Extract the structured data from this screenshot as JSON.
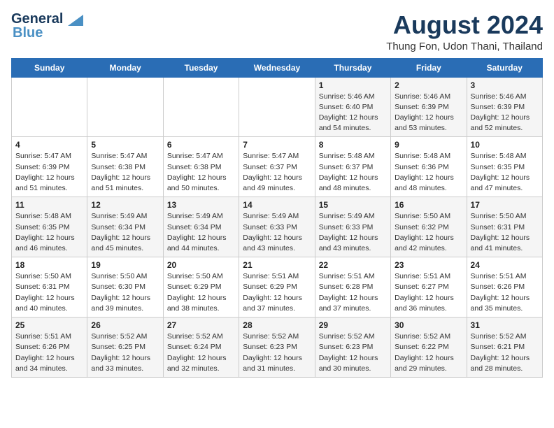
{
  "logo": {
    "line1": "General",
    "line2": "Blue"
  },
  "header": {
    "month_year": "August 2024",
    "location": "Thung Fon, Udon Thani, Thailand"
  },
  "days_of_week": [
    "Sunday",
    "Monday",
    "Tuesday",
    "Wednesday",
    "Thursday",
    "Friday",
    "Saturday"
  ],
  "weeks": [
    [
      {
        "num": "",
        "info": ""
      },
      {
        "num": "",
        "info": ""
      },
      {
        "num": "",
        "info": ""
      },
      {
        "num": "",
        "info": ""
      },
      {
        "num": "1",
        "info": "Sunrise: 5:46 AM\nSunset: 6:40 PM\nDaylight: 12 hours\nand 54 minutes."
      },
      {
        "num": "2",
        "info": "Sunrise: 5:46 AM\nSunset: 6:39 PM\nDaylight: 12 hours\nand 53 minutes."
      },
      {
        "num": "3",
        "info": "Sunrise: 5:46 AM\nSunset: 6:39 PM\nDaylight: 12 hours\nand 52 minutes."
      }
    ],
    [
      {
        "num": "4",
        "info": "Sunrise: 5:47 AM\nSunset: 6:39 PM\nDaylight: 12 hours\nand 51 minutes."
      },
      {
        "num": "5",
        "info": "Sunrise: 5:47 AM\nSunset: 6:38 PM\nDaylight: 12 hours\nand 51 minutes."
      },
      {
        "num": "6",
        "info": "Sunrise: 5:47 AM\nSunset: 6:38 PM\nDaylight: 12 hours\nand 50 minutes."
      },
      {
        "num": "7",
        "info": "Sunrise: 5:47 AM\nSunset: 6:37 PM\nDaylight: 12 hours\nand 49 minutes."
      },
      {
        "num": "8",
        "info": "Sunrise: 5:48 AM\nSunset: 6:37 PM\nDaylight: 12 hours\nand 48 minutes."
      },
      {
        "num": "9",
        "info": "Sunrise: 5:48 AM\nSunset: 6:36 PM\nDaylight: 12 hours\nand 48 minutes."
      },
      {
        "num": "10",
        "info": "Sunrise: 5:48 AM\nSunset: 6:35 PM\nDaylight: 12 hours\nand 47 minutes."
      }
    ],
    [
      {
        "num": "11",
        "info": "Sunrise: 5:48 AM\nSunset: 6:35 PM\nDaylight: 12 hours\nand 46 minutes."
      },
      {
        "num": "12",
        "info": "Sunrise: 5:49 AM\nSunset: 6:34 PM\nDaylight: 12 hours\nand 45 minutes."
      },
      {
        "num": "13",
        "info": "Sunrise: 5:49 AM\nSunset: 6:34 PM\nDaylight: 12 hours\nand 44 minutes."
      },
      {
        "num": "14",
        "info": "Sunrise: 5:49 AM\nSunset: 6:33 PM\nDaylight: 12 hours\nand 43 minutes."
      },
      {
        "num": "15",
        "info": "Sunrise: 5:49 AM\nSunset: 6:33 PM\nDaylight: 12 hours\nand 43 minutes."
      },
      {
        "num": "16",
        "info": "Sunrise: 5:50 AM\nSunset: 6:32 PM\nDaylight: 12 hours\nand 42 minutes."
      },
      {
        "num": "17",
        "info": "Sunrise: 5:50 AM\nSunset: 6:31 PM\nDaylight: 12 hours\nand 41 minutes."
      }
    ],
    [
      {
        "num": "18",
        "info": "Sunrise: 5:50 AM\nSunset: 6:31 PM\nDaylight: 12 hours\nand 40 minutes."
      },
      {
        "num": "19",
        "info": "Sunrise: 5:50 AM\nSunset: 6:30 PM\nDaylight: 12 hours\nand 39 minutes."
      },
      {
        "num": "20",
        "info": "Sunrise: 5:50 AM\nSunset: 6:29 PM\nDaylight: 12 hours\nand 38 minutes."
      },
      {
        "num": "21",
        "info": "Sunrise: 5:51 AM\nSunset: 6:29 PM\nDaylight: 12 hours\nand 37 minutes."
      },
      {
        "num": "22",
        "info": "Sunrise: 5:51 AM\nSunset: 6:28 PM\nDaylight: 12 hours\nand 37 minutes."
      },
      {
        "num": "23",
        "info": "Sunrise: 5:51 AM\nSunset: 6:27 PM\nDaylight: 12 hours\nand 36 minutes."
      },
      {
        "num": "24",
        "info": "Sunrise: 5:51 AM\nSunset: 6:26 PM\nDaylight: 12 hours\nand 35 minutes."
      }
    ],
    [
      {
        "num": "25",
        "info": "Sunrise: 5:51 AM\nSunset: 6:26 PM\nDaylight: 12 hours\nand 34 minutes."
      },
      {
        "num": "26",
        "info": "Sunrise: 5:52 AM\nSunset: 6:25 PM\nDaylight: 12 hours\nand 33 minutes."
      },
      {
        "num": "27",
        "info": "Sunrise: 5:52 AM\nSunset: 6:24 PM\nDaylight: 12 hours\nand 32 minutes."
      },
      {
        "num": "28",
        "info": "Sunrise: 5:52 AM\nSunset: 6:23 PM\nDaylight: 12 hours\nand 31 minutes."
      },
      {
        "num": "29",
        "info": "Sunrise: 5:52 AM\nSunset: 6:23 PM\nDaylight: 12 hours\nand 30 minutes."
      },
      {
        "num": "30",
        "info": "Sunrise: 5:52 AM\nSunset: 6:22 PM\nDaylight: 12 hours\nand 29 minutes."
      },
      {
        "num": "31",
        "info": "Sunrise: 5:52 AM\nSunset: 6:21 PM\nDaylight: 12 hours\nand 28 minutes."
      }
    ]
  ]
}
